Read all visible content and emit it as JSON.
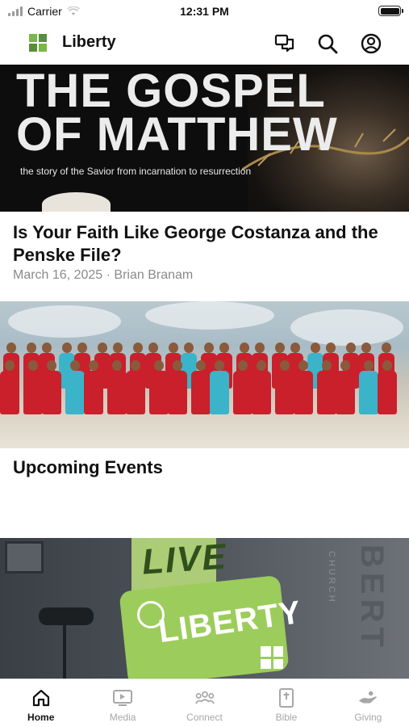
{
  "status_bar": {
    "carrier": "Carrier",
    "time": "12:31 PM"
  },
  "header": {
    "title": "Liberty",
    "icons": [
      "chat-bubbles-icon",
      "search-icon",
      "profile-icon"
    ]
  },
  "hero": {
    "title_line1": "THE GOSPEL",
    "title_line2": "OF MATTHEW",
    "subtitle": "the story of the Savior from incarnation to resurrection"
  },
  "article": {
    "title": "Is Your Faith Like George Costanza and the Penske File?",
    "meta": "March 16, 2025 · Brian Branam"
  },
  "events": {
    "title": "Upcoming Events"
  },
  "live_card": {
    "line1": "LIVE",
    "line2": "LIBERTY",
    "side_text": "BERT",
    "church_text": "CHURCH"
  },
  "tabs": [
    {
      "label": "Home",
      "icon": "home-icon",
      "active": true
    },
    {
      "label": "Media",
      "icon": "media-icon",
      "active": false
    },
    {
      "label": "Connect",
      "icon": "connect-icon",
      "active": false
    },
    {
      "label": "Bible",
      "icon": "bible-icon",
      "active": false
    },
    {
      "label": "Giving",
      "icon": "giving-icon",
      "active": false
    }
  ],
  "colors": {
    "accent_green": "#7ab648",
    "tab_inactive": "#a7a7a7",
    "photo_shirt_red": "#c9202c"
  }
}
